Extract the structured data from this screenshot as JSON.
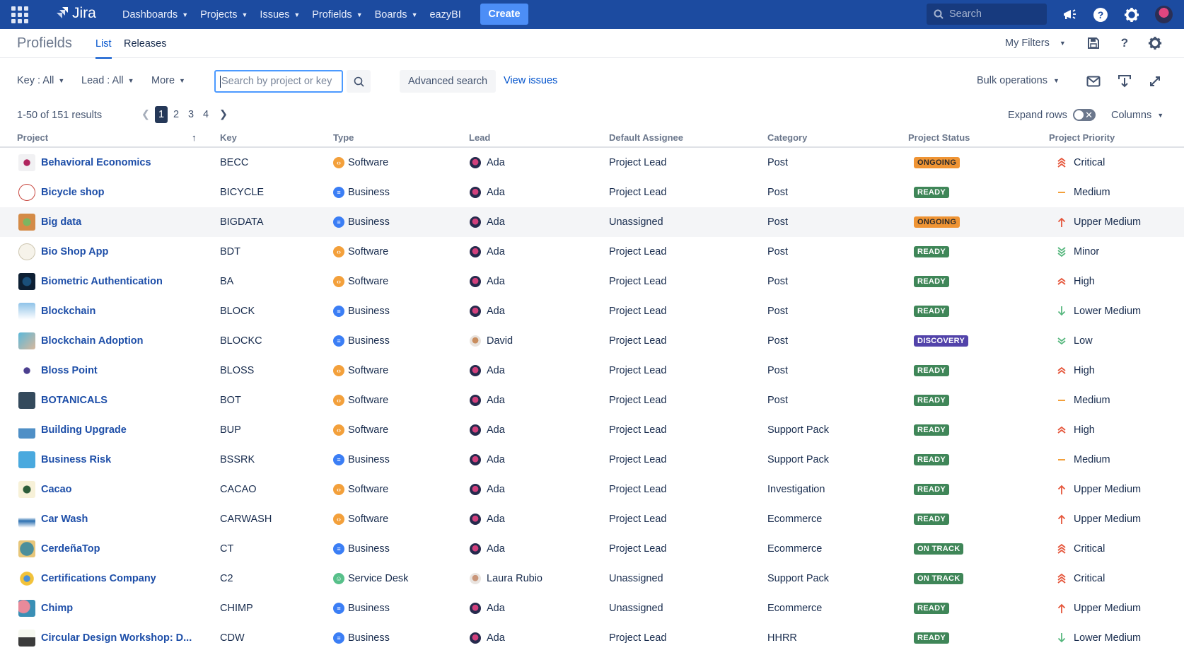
{
  "topnav": {
    "logo_text": "Jira",
    "items": [
      {
        "label": "Dashboards",
        "has_dropdown": true
      },
      {
        "label": "Projects",
        "has_dropdown": true
      },
      {
        "label": "Issues",
        "has_dropdown": true
      },
      {
        "label": "Profields",
        "has_dropdown": true
      },
      {
        "label": "Boards",
        "has_dropdown": true
      },
      {
        "label": "eazyBI",
        "has_dropdown": false
      }
    ],
    "create_label": "Create",
    "search_placeholder": "Search",
    "icons": [
      "notifications-megaphone-icon",
      "help-icon",
      "settings-gear-icon",
      "user-avatar"
    ]
  },
  "subheader": {
    "title": "Profields",
    "tabs": [
      {
        "label": "List",
        "active": true
      },
      {
        "label": "Releases",
        "active": false
      }
    ],
    "my_filters_label": "My Filters",
    "icons": [
      "save-icon",
      "help-icon",
      "settings-gear-icon"
    ]
  },
  "filters": {
    "key_label": "Key : All",
    "lead_label": "Lead : All",
    "more_label": "More",
    "search_placeholder": "Search by project or key",
    "search_value": "",
    "advanced_search_label": "Advanced search",
    "view_issues_label": "View issues",
    "bulk_operations_label": "Bulk operations",
    "icons": [
      "email-icon",
      "export-icon",
      "fullscreen-icon"
    ]
  },
  "pagination": {
    "results_text": "1-50 of 151 results",
    "pages": [
      "1",
      "2",
      "3",
      "4"
    ],
    "current_page": "1",
    "expand_rows_label": "Expand rows",
    "expand_rows_on": false,
    "columns_label": "Columns"
  },
  "table": {
    "headers": {
      "project": "Project",
      "key": "Key",
      "type": "Type",
      "lead": "Lead",
      "assignee": "Default Assignee",
      "category": "Category",
      "status": "Project Status",
      "priority": "Project Priority"
    },
    "sort": {
      "column": "Project",
      "direction": "ascending"
    },
    "rows": [
      {
        "name": "Behavioral Economics",
        "key": "BECC",
        "type": "Software",
        "lead": "Ada",
        "assignee": "Project Lead",
        "category": "Post",
        "status": "ONGOING",
        "priority": "Critical"
      },
      {
        "name": "Bicycle shop",
        "key": "BICYCLE",
        "type": "Business",
        "lead": "Ada",
        "assignee": "Project Lead",
        "category": "Post",
        "status": "READY",
        "priority": "Medium"
      },
      {
        "name": "Big data",
        "key": "BIGDATA",
        "type": "Business",
        "lead": "Ada",
        "assignee": "Unassigned",
        "category": "Post",
        "status": "ONGOING",
        "priority": "Upper Medium"
      },
      {
        "name": "Bio Shop App",
        "key": "BDT",
        "type": "Software",
        "lead": "Ada",
        "assignee": "Project Lead",
        "category": "Post",
        "status": "READY",
        "priority": "Minor"
      },
      {
        "name": "Biometric Authentication",
        "key": "BA",
        "type": "Software",
        "lead": "Ada",
        "assignee": "Project Lead",
        "category": "Post",
        "status": "READY",
        "priority": "High"
      },
      {
        "name": "Blockchain",
        "key": "BLOCK",
        "type": "Business",
        "lead": "Ada",
        "assignee": "Project Lead",
        "category": "Post",
        "status": "READY",
        "priority": "Lower Medium"
      },
      {
        "name": "Blockchain Adoption",
        "key": "BLOCKC",
        "type": "Business",
        "lead": "David",
        "assignee": "Project Lead",
        "category": "Post",
        "status": "DISCOVERY",
        "priority": "Low"
      },
      {
        "name": "Bloss Point",
        "key": "BLOSS",
        "type": "Software",
        "lead": "Ada",
        "assignee": "Project Lead",
        "category": "Post",
        "status": "READY",
        "priority": "High"
      },
      {
        "name": "BOTANICALS",
        "key": "BOT",
        "type": "Software",
        "lead": "Ada",
        "assignee": "Project Lead",
        "category": "Post",
        "status": "READY",
        "priority": "Medium"
      },
      {
        "name": "Building Upgrade",
        "key": "BUP",
        "type": "Software",
        "lead": "Ada",
        "assignee": "Project Lead",
        "category": "Support Pack",
        "status": "READY",
        "priority": "High"
      },
      {
        "name": "Business Risk",
        "key": "BSSRK",
        "type": "Business",
        "lead": "Ada",
        "assignee": "Project Lead",
        "category": "Support Pack",
        "status": "READY",
        "priority": "Medium"
      },
      {
        "name": "Cacao",
        "key": "CACAO",
        "type": "Software",
        "lead": "Ada",
        "assignee": "Project Lead",
        "category": "Investigation",
        "status": "READY",
        "priority": "Upper Medium"
      },
      {
        "name": "Car Wash",
        "key": "CARWASH",
        "type": "Software",
        "lead": "Ada",
        "assignee": "Project Lead",
        "category": "Ecommerce",
        "status": "READY",
        "priority": "Upper Medium"
      },
      {
        "name": "CerdeñaTop",
        "key": "CT",
        "type": "Business",
        "lead": "Ada",
        "assignee": "Project Lead",
        "category": "Ecommerce",
        "status": "ON TRACK",
        "priority": "Critical"
      },
      {
        "name": "Certifications Company",
        "key": "C2",
        "type": "Service Desk",
        "lead": "Laura Rubio",
        "assignee": "Unassigned",
        "category": "Support Pack",
        "status": "ON TRACK",
        "priority": "Critical"
      },
      {
        "name": "Chimp",
        "key": "CHIMP",
        "type": "Business",
        "lead": "Ada",
        "assignee": "Unassigned",
        "category": "Ecommerce",
        "status": "READY",
        "priority": "Upper Medium"
      },
      {
        "name": "Circular Design Workshop: D...",
        "key": "CDW",
        "type": "Business",
        "lead": "Ada",
        "assignee": "Project Lead",
        "category": "HHRR",
        "status": "READY",
        "priority": "Lower Medium"
      }
    ]
  },
  "colors": {
    "navbar": "#1c4ba0",
    "create_button": "#4c8ef7",
    "link": "#1d4ea8",
    "status_ongoing": "#ef9434",
    "status_ready": "#3f8658",
    "status_discovery": "#5243aa",
    "status_on_track": "#3f8658",
    "priority_up": "#e5553a",
    "priority_down": "#57b77e",
    "priority_medium": "#f3a03b"
  }
}
